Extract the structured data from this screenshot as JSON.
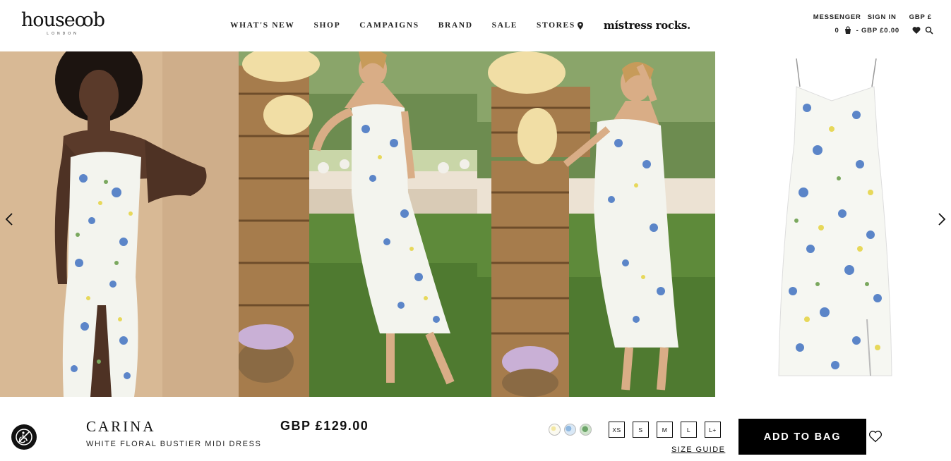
{
  "brand": {
    "logo_text": "house of cb",
    "logo_mark": "houseꝏb",
    "logo_sub": "LONDON"
  },
  "nav": {
    "items": [
      "WHAT'S NEW",
      "SHOP",
      "CAMPAIGNS",
      "BRAND",
      "SALE",
      "STORES"
    ],
    "stores_icon": "map-pin-icon",
    "campaign_link": "místress rocks."
  },
  "utility": {
    "messenger": "MESSENGER",
    "sign_in": "SIGN IN",
    "currency": "GBP £",
    "bag_count": "0",
    "bag_total": "- GBP £0.00",
    "icons": [
      "bag-icon",
      "heart-icon",
      "search-icon"
    ]
  },
  "gallery": {
    "images": [
      "model-front-studio",
      "model-crates-garden",
      "model-crates-arranging",
      "dress-flatlay"
    ],
    "prev_icon": "chevron-left-icon",
    "next_icon": "chevron-right-icon"
  },
  "product": {
    "name": "CARINA",
    "subtitle": "WHITE FLORAL BUSTIER MIDI DRESS",
    "price": "GBP £129.00",
    "swatches": [
      "yellow-floral",
      "blue-floral",
      "green-floral"
    ],
    "sizes": [
      "XS",
      "S",
      "M",
      "L",
      "L+"
    ],
    "size_guide": "SIZE GUIDE",
    "add_to_bag": "ADD TO BAG"
  },
  "colors": {
    "accent": "#000000",
    "background": "#ffffff"
  }
}
